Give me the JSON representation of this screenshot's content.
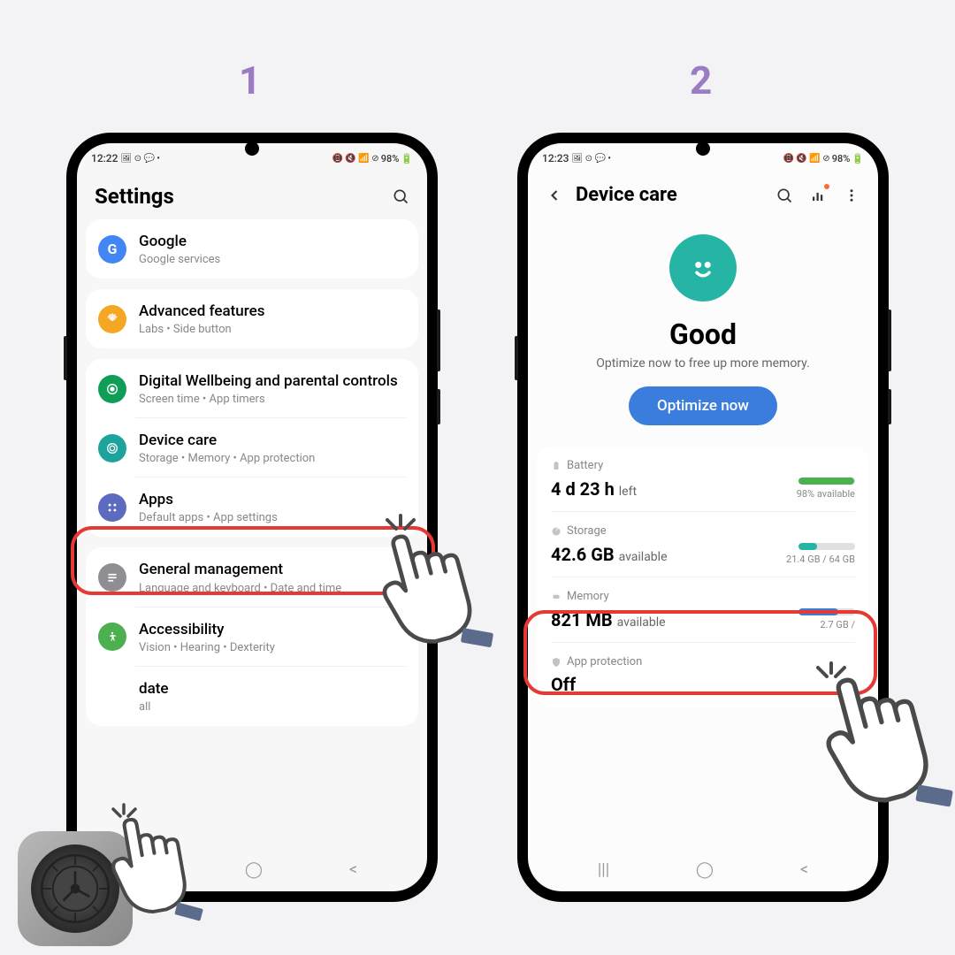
{
  "steps": {
    "one": "1",
    "two": "2"
  },
  "phone1": {
    "status": {
      "time": "12:22",
      "icons": "🖼 ⊙ 💬 •",
      "right": "🔔 🔇 📶 ⊘ 98%🔋",
      "battery": "98%"
    },
    "header": {
      "title": "Settings"
    },
    "items": {
      "google": {
        "title": "Google",
        "subtitle": "Google services"
      },
      "advanced": {
        "title": "Advanced features",
        "subtitle": "Labs  •  Side button"
      },
      "wellbeing": {
        "title": "Digital Wellbeing and parental controls",
        "subtitle": "Screen time  •  App timers"
      },
      "devicecare": {
        "title": "Device care",
        "subtitle": "Storage  •  Memory  •  App protection"
      },
      "apps": {
        "title": "Apps",
        "subtitle": "Default apps  •  App settings"
      },
      "general": {
        "title": "General management",
        "subtitle": "Language and keyboard  •  Date and time"
      },
      "accessibility": {
        "title": "Accessibility",
        "subtitle": "Vision  •  Hearing  •  Dexterity"
      },
      "update": {
        "title": "date",
        "subtitle": "all"
      }
    }
  },
  "phone2": {
    "status": {
      "time": "12:23",
      "battery": "98%"
    },
    "header": {
      "title": "Device care"
    },
    "device": {
      "status": "Good",
      "subtitle": "Optimize now to free up more memory.",
      "button": "Optimize now"
    },
    "battery": {
      "label": "Battery",
      "value": "4 d 23 h",
      "unit": "left",
      "detail": "98% available"
    },
    "storage": {
      "label": "Storage",
      "value": "42.6 GB",
      "unit": "available",
      "detail": "21.4 GB / 64 GB"
    },
    "memory": {
      "label": "Memory",
      "value": "821 MB",
      "unit": "available",
      "detail": "2.7 GB /"
    },
    "protection": {
      "label": "App protection",
      "value": "Off"
    }
  }
}
